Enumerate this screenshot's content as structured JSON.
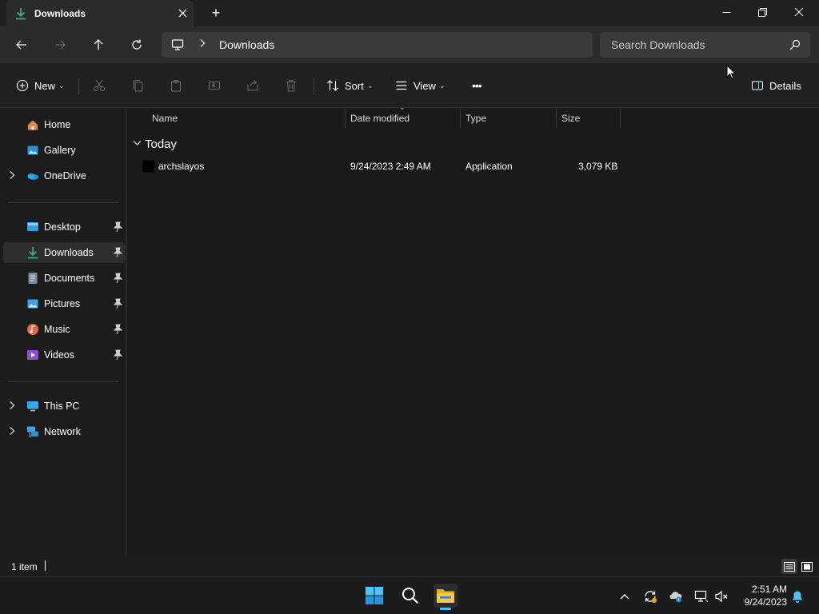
{
  "window": {
    "tab_title": "Downloads",
    "new_tab_symbol": "+"
  },
  "address": {
    "crumb": "Downloads",
    "search_placeholder": "Search Downloads"
  },
  "commands": {
    "new": "New",
    "sort": "Sort",
    "view": "View",
    "more": "•••",
    "details": "Details"
  },
  "sidebar": {
    "items": [
      {
        "label": "Home",
        "icon": "home-icon"
      },
      {
        "label": "Gallery",
        "icon": "gallery-icon"
      },
      {
        "label": "OneDrive",
        "icon": "onedrive-icon"
      },
      {
        "label": "Desktop",
        "icon": "desktop-icon"
      },
      {
        "label": "Downloads",
        "icon": "downloads-icon"
      },
      {
        "label": "Documents",
        "icon": "documents-icon"
      },
      {
        "label": "Pictures",
        "icon": "pictures-icon"
      },
      {
        "label": "Music",
        "icon": "music-icon"
      },
      {
        "label": "Videos",
        "icon": "videos-icon"
      },
      {
        "label": "This PC",
        "icon": "this-pc-icon"
      },
      {
        "label": "Network",
        "icon": "network-icon"
      }
    ]
  },
  "list": {
    "columns": [
      "Name",
      "Date modified",
      "Type",
      "Size"
    ],
    "group": "Today",
    "files": [
      {
        "name": "archslayos",
        "date": "9/24/2023 2:49 AM",
        "type": "Application",
        "size": "3,079 KB"
      }
    ]
  },
  "status": {
    "count": "1 item"
  },
  "taskbar": {
    "time": "2:51 AM",
    "date": "9/24/2023"
  },
  "colors": {
    "accent": "#4cc2ff",
    "background": "#191919",
    "downloads_green": "#3fb97a"
  }
}
